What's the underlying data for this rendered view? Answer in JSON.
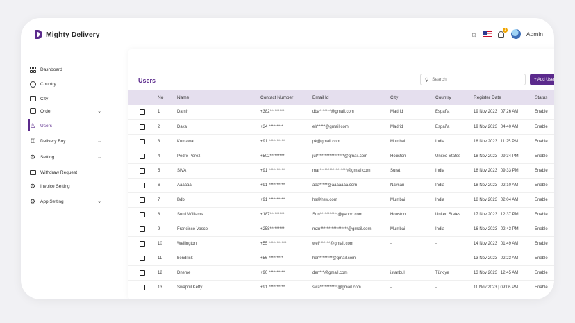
{
  "app": {
    "brand": "Mighty Delivery",
    "admin_label": "Admin",
    "notification_count": "1"
  },
  "colors": {
    "accent": "#5b2a8c",
    "header_bg": "#e5dfee"
  },
  "sidebar": {
    "items": [
      {
        "label": "Dashboard",
        "icon": "dashboard-grid-icon"
      },
      {
        "label": "Country",
        "icon": "globe-icon"
      },
      {
        "label": "City",
        "icon": "city-icon"
      },
      {
        "label": "Order",
        "icon": "order-icon",
        "expandable": true
      },
      {
        "label": "Users",
        "icon": "user-icon",
        "active": true
      },
      {
        "label": "Delivery Boy",
        "icon": "delivery-boy-icon",
        "expandable": true
      },
      {
        "label": "Setting",
        "icon": "gear-icon",
        "expandable": true
      },
      {
        "label": "Withdraw Request",
        "icon": "withdraw-icon"
      },
      {
        "label": "Invoice Setting",
        "icon": "gear-icon"
      },
      {
        "label": "App Setting",
        "icon": "gear-icon",
        "expandable": true
      }
    ]
  },
  "main": {
    "title": "Users",
    "search_placeholder": "Search",
    "add_button": "+ Add User",
    "columns": [
      "No",
      "Name",
      "Contact Number",
      "Email Id",
      "City",
      "Country",
      "Register Date",
      "Status"
    ],
    "rows": [
      {
        "no": "1",
        "name": "Damir",
        "contact": "+382*********",
        "email": "dba*******@gmail.com",
        "city": "Madrid",
        "country": "España",
        "date": "19 Nov 2023 | 07:26 AM",
        "status": "Enable"
      },
      {
        "no": "2",
        "name": "Daka",
        "contact": "+34 *********",
        "email": "elr*****@gmail.com",
        "city": "Madrid",
        "country": "España",
        "date": "19 Nov 2023 | 04:40 AM",
        "status": "Enable"
      },
      {
        "no": "3",
        "name": "Kumawat",
        "contact": "+91 **********",
        "email": "pk@gmail.com",
        "city": "Mumbai",
        "country": "India",
        "date": "18 Nov 2023 | 11:25 PM",
        "status": "Enable"
      },
      {
        "no": "4",
        "name": "Pedro Perez",
        "contact": "+502*********",
        "email": "jul*****************@gmail.com",
        "city": "Houston",
        "country": "United States",
        "date": "18 Nov 2023 | 09:34 PM",
        "status": "Enable"
      },
      {
        "no": "5",
        "name": "SIVA",
        "contact": "+91 **********",
        "email": "mar*****************@gmail.com",
        "city": "Surat",
        "country": "India",
        "date": "18 Nov 2023 | 09:33 PM",
        "status": "Enable"
      },
      {
        "no": "6",
        "name": "Aaaaaa",
        "contact": "+91 **********",
        "email": "aaa*****@aaaaaaa.com",
        "city": "Navsari",
        "country": "India",
        "date": "18 Nov 2023 | 02:10 AM",
        "status": "Enable"
      },
      {
        "no": "7",
        "name": "Bdb",
        "contact": "+91 **********",
        "email": "hs@hsw.com",
        "city": "Mumbai",
        "country": "India",
        "date": "18 Nov 2023 | 02:04 AM",
        "status": "Enable"
      },
      {
        "no": "8",
        "name": "Sunil Williams",
        "contact": "+187*********",
        "email": "Sun***********@yahoo.com",
        "city": "Houston",
        "country": "United States",
        "date": "17 Nov 2023 | 12:37 PM",
        "status": "Enable"
      },
      {
        "no": "9",
        "name": "Francisco Vasco",
        "contact": "+258*********",
        "email": "mzn*****************@gmail.com",
        "city": "Mumbai",
        "country": "India",
        "date": "16 Nov 2023 | 02:43 PM",
        "status": "Enable"
      },
      {
        "no": "10",
        "name": "Wellington",
        "contact": "+55 ***********",
        "email": "wel*******@gmail.com",
        "city": "-",
        "country": "-",
        "date": "14 Nov 2023 | 01:49 AM",
        "status": "Enable"
      },
      {
        "no": "11",
        "name": "hendrick",
        "contact": "+56 *********",
        "email": "hen********@gmail.com",
        "city": "-",
        "country": "-",
        "date": "13 Nov 2023 | 02:23 AM",
        "status": "Enable"
      },
      {
        "no": "12",
        "name": "Dneme",
        "contact": "+90 **********",
        "email": "den***@gmail.com",
        "city": "istanbul",
        "country": "Türkiye",
        "date": "13 Nov 2023 | 12:45 AM",
        "status": "Enable"
      },
      {
        "no": "13",
        "name": "Swapnil Ketty",
        "contact": "+91 **********",
        "email": "swa***********@gmail.com",
        "city": "-",
        "country": "-",
        "date": "11 Nov 2023 | 09:06 PM",
        "status": "Enable"
      }
    ]
  }
}
